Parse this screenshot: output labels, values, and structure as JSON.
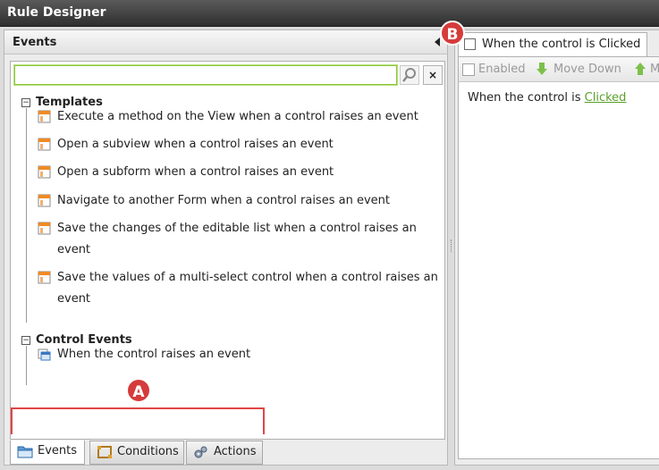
{
  "window": {
    "title": "Rule Designer"
  },
  "left_pane": {
    "title": "Events",
    "search": {
      "value": "",
      "placeholder": ""
    },
    "groups": [
      {
        "label": "Templates",
        "toggle": "−",
        "items": [
          {
            "label": "Execute a method on the View when a control raises an event"
          },
          {
            "label": "Open a subview when a control raises an event"
          },
          {
            "label": "Open a subform when a control raises an event"
          },
          {
            "label": "Navigate to another Form when a control raises an event"
          },
          {
            "label": "Save the changes of the editable list when a control raises an",
            "label2": "event"
          },
          {
            "label": "Save the values of a multi-select control when a control raises an",
            "label2": "event"
          }
        ]
      },
      {
        "label": "Control Events",
        "toggle": "−",
        "items": [
          {
            "label": "When the control raises an event"
          }
        ]
      }
    ],
    "tabs": [
      {
        "label": "Events",
        "icon": "folder-icon"
      },
      {
        "label": "Conditions",
        "icon": "conditions-icon"
      },
      {
        "label": "Actions",
        "icon": "gears-icon"
      }
    ],
    "clear_label": "×"
  },
  "right_pane": {
    "tab_label": "When the control is Clicked",
    "toolbar": {
      "enabled": "Enabled",
      "move_down": "Move Down",
      "move_up": "M"
    },
    "rule_prefix": "When the control is ",
    "rule_link": "Clicked"
  },
  "annotations": {
    "a": "A",
    "b": "B"
  },
  "colors": {
    "accent": "#8cc63f",
    "marker": "#d63b3b",
    "link": "#5aa02c"
  }
}
